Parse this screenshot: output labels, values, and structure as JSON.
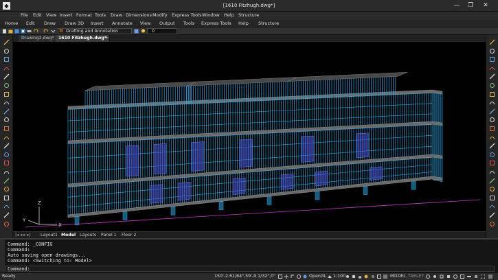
{
  "window": {
    "title": "[1610 Fitzhugh.dwg*]",
    "logo_glyph": "◆",
    "minimize_glyph": "—",
    "maximize_glyph": "❐",
    "close_glyph": "✕"
  },
  "menu": [
    "File",
    "Edit",
    "View",
    "Insert",
    "Format",
    "Tools",
    "Draw",
    "Dimensions",
    "Modify",
    "Express Tools",
    "Window",
    "Help",
    "Structure"
  ],
  "ribbon_tabs": [
    "Home",
    "Edit",
    "Draw",
    "Draw 3D",
    "Insert",
    "Annotate",
    "View",
    "Output",
    "Tools",
    "Express Tools",
    "Help",
    "Structure"
  ],
  "toolbar": {
    "workspace": "Drafting and Annotation",
    "layer": "0"
  },
  "document_tabs": [
    "Drawing2.dwg*",
    "1610 Fitzhugh.dwg*"
  ],
  "new_tab_glyph": "+",
  "layout_tabs": [
    "Layout1",
    "Model",
    "Layouts",
    "Panel 1",
    "Floor 2"
  ],
  "ucs": {
    "x_label": "X",
    "y_label": "Y",
    "z_label": "Z"
  },
  "command_history": [
    "Command: _CONFIG",
    "Command:",
    "Auto saving open drawings...",
    "Command: <Switching to: Model>"
  ],
  "command_prompt": "Command:",
  "status": {
    "state": "Ready",
    "coordinates": "150'-2 61/64\",59'-9 1/32\",0\"",
    "renderer": "OpenGL",
    "scale": "1:100",
    "mode": "MODEL",
    "tablet": "TABLET"
  },
  "colors": {
    "framing": "#2aa7e4",
    "glass": "#4a4ac8",
    "floor": "#6a6a6a",
    "accent": "#f0a030"
  },
  "icons": {
    "left_toolbar": [
      "line-icon",
      "polyline-icon",
      "polygon-icon",
      "rectangle-icon",
      "arc-icon",
      "circle-icon",
      "revcloud-icon",
      "spline-icon",
      "ellipse-icon",
      "ellipse-arc-icon",
      "insert-block-icon",
      "make-block-icon",
      "point-icon",
      "hatch-icon",
      "gradient-icon",
      "region-icon",
      "table-icon",
      "mtext-icon",
      "text-icon",
      "wipeout-icon",
      "boundary-icon",
      "donut-icon"
    ],
    "right_toolbar": [
      "erase-icon",
      "copy-icon",
      "mirror-icon",
      "offset-icon",
      "array-icon",
      "move-icon",
      "rotate-icon",
      "scale-icon",
      "stretch-icon",
      "trim-icon",
      "extend-icon",
      "break-icon",
      "join-icon",
      "chamfer-icon",
      "fillet-icon",
      "explode-icon",
      "edit-polyline-icon",
      "align-icon",
      "lengthen-icon",
      "properties-icon",
      "matchprop-icon",
      "layer-icon"
    ]
  }
}
